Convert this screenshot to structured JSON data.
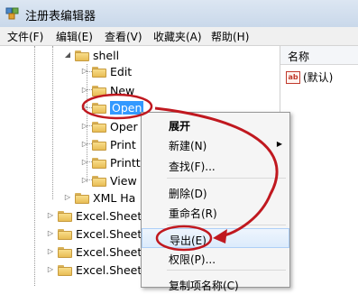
{
  "window": {
    "title": "注册表编辑器"
  },
  "menubar": [
    {
      "label": "文件(F)"
    },
    {
      "label": "编辑(E)"
    },
    {
      "label": "查看(V)"
    },
    {
      "label": "收藏夹(A)"
    },
    {
      "label": "帮助(H)"
    }
  ],
  "tree": {
    "parent": "shell",
    "children": [
      "Edit",
      "New",
      "Open",
      "Oper",
      "Print",
      "Printt",
      "View"
    ],
    "siblings": [
      "XML Ha",
      "Excel.Sheet",
      "Excel.Sheet.",
      "Excel.Sheet.",
      "Excel.Sheet"
    ]
  },
  "right_pane": {
    "column": "名称",
    "value_name": "(默认)",
    "value_icon": "ab-string-icon"
  },
  "context_menu": {
    "items": [
      "展开",
      "新建(N)",
      "查找(F)...",
      "删除(D)",
      "重命名(R)",
      "导出(E)",
      "权限(P)...",
      "复制项名称(C)"
    ],
    "highlighted": "导出(E)"
  },
  "annotation": {
    "color": "#c0181f"
  }
}
